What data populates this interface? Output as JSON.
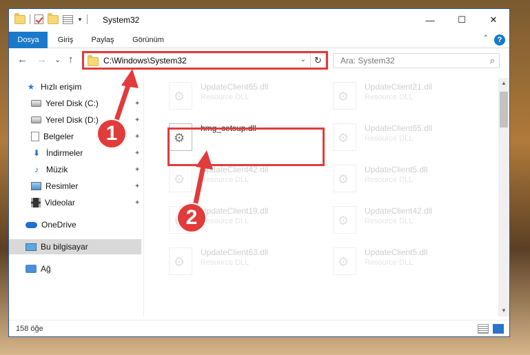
{
  "titlebar": {
    "title": "System32",
    "minimize": "—",
    "maximize": "☐",
    "close": "✕"
  },
  "ribbon": {
    "tabs": [
      "Dosya",
      "Giriş",
      "Paylaş",
      "Görünüm"
    ],
    "help": "?",
    "collapse": "⌃"
  },
  "nav": {
    "back": "←",
    "forward": "→",
    "recent": "⌄",
    "up": "↑",
    "address": "C:\\Windows\\System32",
    "dropdown": "⌄",
    "refresh": "↻",
    "search_placeholder": "Ara: System32",
    "search_icon": "⌕"
  },
  "sidebar": {
    "items": [
      {
        "label": "Hızlı erişim",
        "icon": "star-icon",
        "pinned": false
      },
      {
        "label": "Yerel Disk (C:)",
        "icon": "disk-icon",
        "pinned": true
      },
      {
        "label": "Yerel Disk (D:)",
        "icon": "disk-icon",
        "pinned": true
      },
      {
        "label": "Belgeler",
        "icon": "document-icon",
        "pinned": true
      },
      {
        "label": "İndirmeler",
        "icon": "download-icon",
        "pinned": true
      },
      {
        "label": "Müzik",
        "icon": "music-icon",
        "pinned": true
      },
      {
        "label": "Resimler",
        "icon": "pictures-icon",
        "pinned": true
      },
      {
        "label": "Videolar",
        "icon": "video-icon",
        "pinned": true
      },
      {
        "label": "OneDrive",
        "icon": "cloud-icon",
        "pinned": false
      },
      {
        "label": "Bu bilgisayar",
        "icon": "computer-icon",
        "pinned": false,
        "selected": true
      },
      {
        "label": "Ağ",
        "icon": "network-icon",
        "pinned": false
      }
    ],
    "pin_glyph": "📌"
  },
  "files": {
    "left": [
      {
        "name": "UpdateClient65.dll",
        "type": "Resource DLL",
        "faded": true
      },
      {
        "name": "hmg_cetsup.dll",
        "type": "",
        "faded": false
      },
      {
        "name": "UpdateClient42.dll",
        "type": "Resource DLL",
        "faded": true
      },
      {
        "name": "UpdateClient19.dll",
        "type": "Resource DLL",
        "faded": true
      },
      {
        "name": "UpdateClient63.dll",
        "type": "Resource DLL",
        "faded": true
      }
    ],
    "right": [
      {
        "name": "UpdateClient21.dll",
        "type": "Resource DLL",
        "faded": true
      },
      {
        "name": "UpdateClient65.dll",
        "type": "Resource DLL",
        "faded": true
      },
      {
        "name": "UpdateClient5.dll",
        "type": "Resource DLL",
        "faded": true
      },
      {
        "name": "UpdateClient42.dll",
        "type": "Resource DLL",
        "faded": true
      },
      {
        "name": "UpdateClient5.dll",
        "type": "Resource DLL",
        "faded": true
      }
    ]
  },
  "status": {
    "item_count": "158 öğe"
  },
  "annotations": {
    "step1": "1",
    "step2": "2",
    "color": "#e23b3b"
  }
}
